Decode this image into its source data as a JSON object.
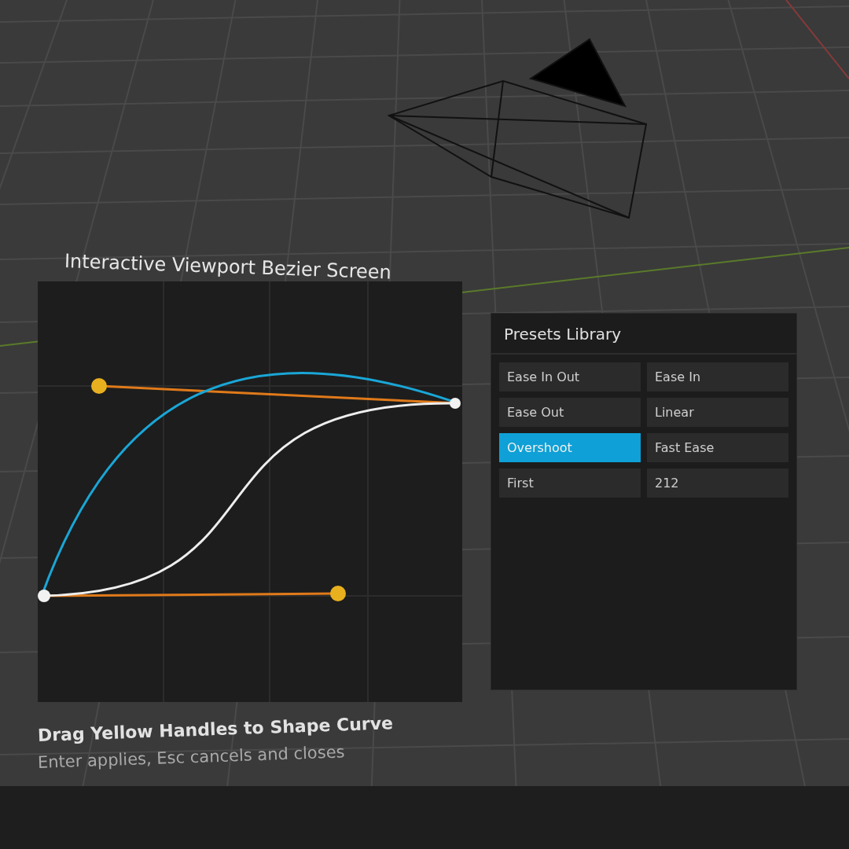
{
  "editor": {
    "title": "Interactive Viewport Bezier Screen"
  },
  "presets": {
    "title": "Presets Library",
    "items": [
      {
        "label": "Ease In Out",
        "selected": false
      },
      {
        "label": "Ease In",
        "selected": false
      },
      {
        "label": "Ease Out",
        "selected": false
      },
      {
        "label": "Linear",
        "selected": false
      },
      {
        "label": "Overshoot",
        "selected": true
      },
      {
        "label": "Fast Ease",
        "selected": false
      },
      {
        "label": "First",
        "selected": false
      },
      {
        "label": "212",
        "selected": false
      }
    ]
  },
  "hint": {
    "heading": "Drag Yellow Handles to Shape Curve",
    "subtext": "Enter applies, Esc cancels and closes"
  }
}
